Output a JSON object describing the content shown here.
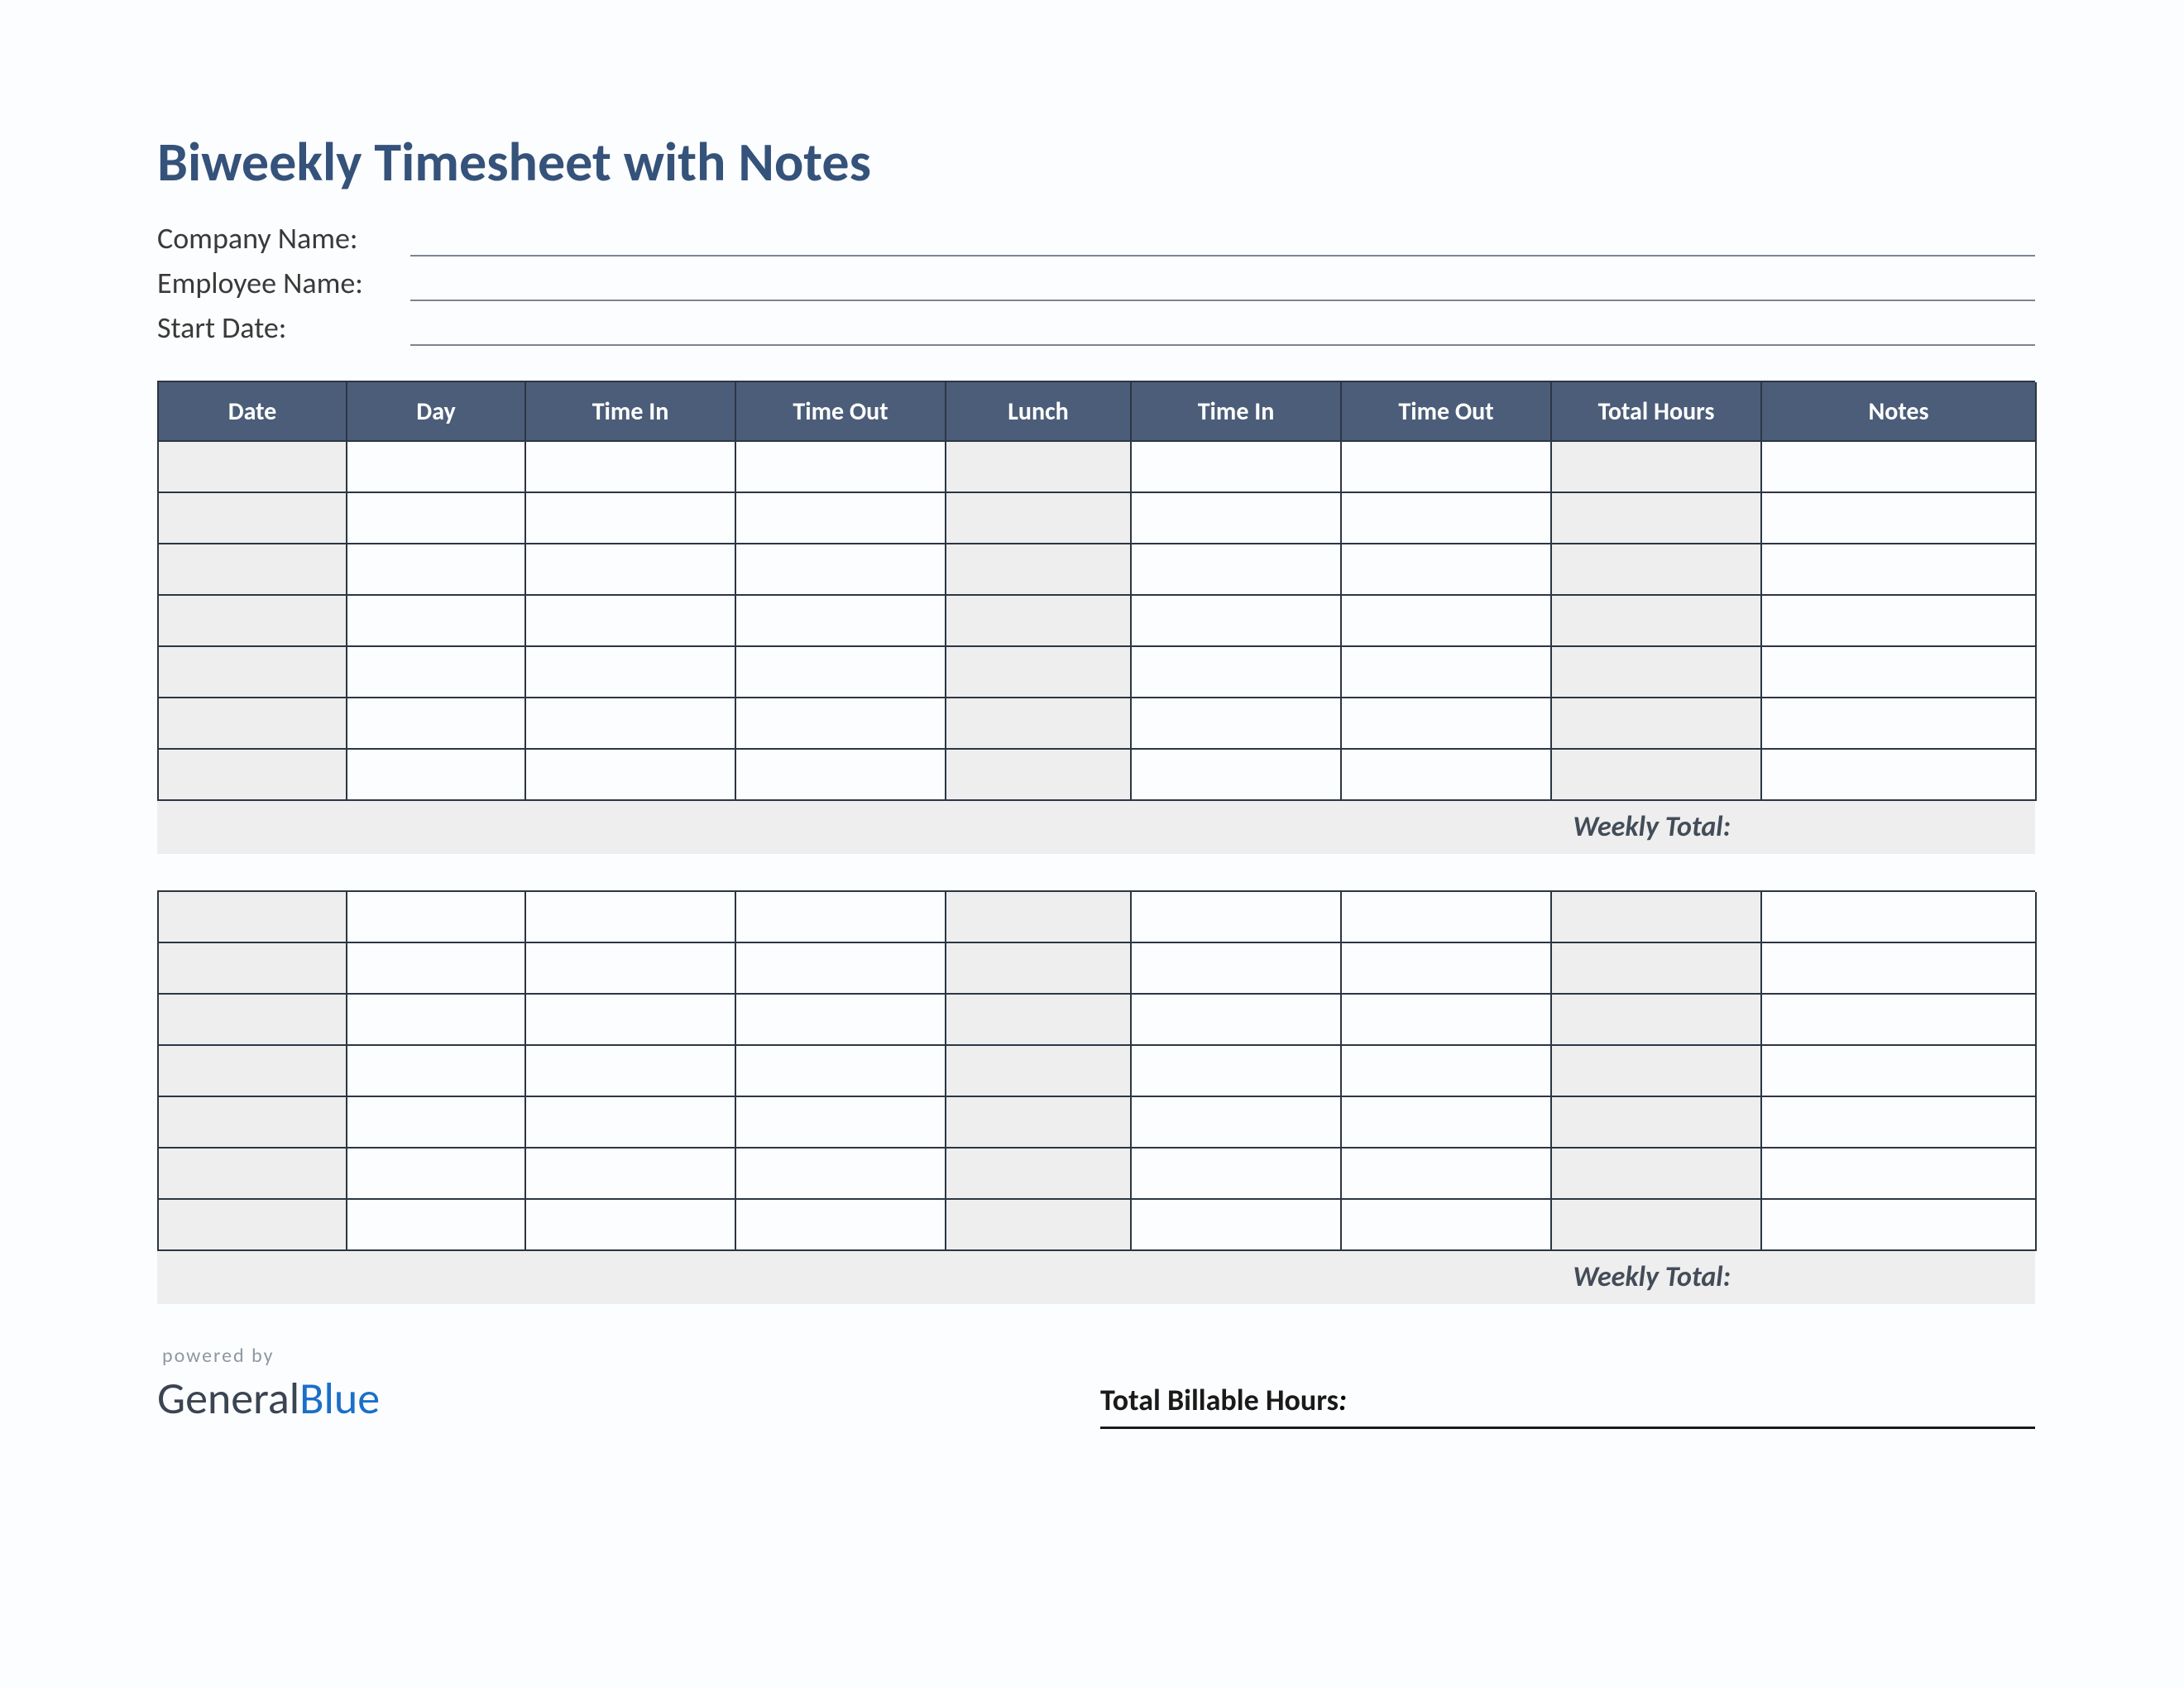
{
  "title": "Biweekly Timesheet with Notes",
  "fields": {
    "company": "Company Name:",
    "employee": "Employee Name:",
    "startdate": "Start Date:"
  },
  "columns": [
    "Date",
    "Day",
    "Time In",
    "Time Out",
    "Lunch",
    "Time In",
    "Time Out",
    "Total Hours",
    "Notes"
  ],
  "weekly_total_label": "Weekly Total:",
  "total_billable_label": "Total Billable Hours",
  "brand": {
    "powered": "powered by",
    "part1": "General",
    "part2": "Blue"
  },
  "week1": [
    [
      "",
      "",
      "",
      "",
      "",
      "",
      "",
      "",
      ""
    ],
    [
      "",
      "",
      "",
      "",
      "",
      "",
      "",
      "",
      ""
    ],
    [
      "",
      "",
      "",
      "",
      "",
      "",
      "",
      "",
      ""
    ],
    [
      "",
      "",
      "",
      "",
      "",
      "",
      "",
      "",
      ""
    ],
    [
      "",
      "",
      "",
      "",
      "",
      "",
      "",
      "",
      ""
    ],
    [
      "",
      "",
      "",
      "",
      "",
      "",
      "",
      "",
      ""
    ],
    [
      "",
      "",
      "",
      "",
      "",
      "",
      "",
      "",
      ""
    ]
  ],
  "week2": [
    [
      "",
      "",
      "",
      "",
      "",
      "",
      "",
      "",
      ""
    ],
    [
      "",
      "",
      "",
      "",
      "",
      "",
      "",
      "",
      ""
    ],
    [
      "",
      "",
      "",
      "",
      "",
      "",
      "",
      "",
      ""
    ],
    [
      "",
      "",
      "",
      "",
      "",
      "",
      "",
      "",
      ""
    ],
    [
      "",
      "",
      "",
      "",
      "",
      "",
      "",
      "",
      ""
    ],
    [
      "",
      "",
      "",
      "",
      "",
      "",
      "",
      "",
      ""
    ],
    [
      "",
      "",
      "",
      "",
      "",
      "",
      "",
      "",
      ""
    ]
  ],
  "shaded_cols": [
    0,
    4,
    7
  ]
}
